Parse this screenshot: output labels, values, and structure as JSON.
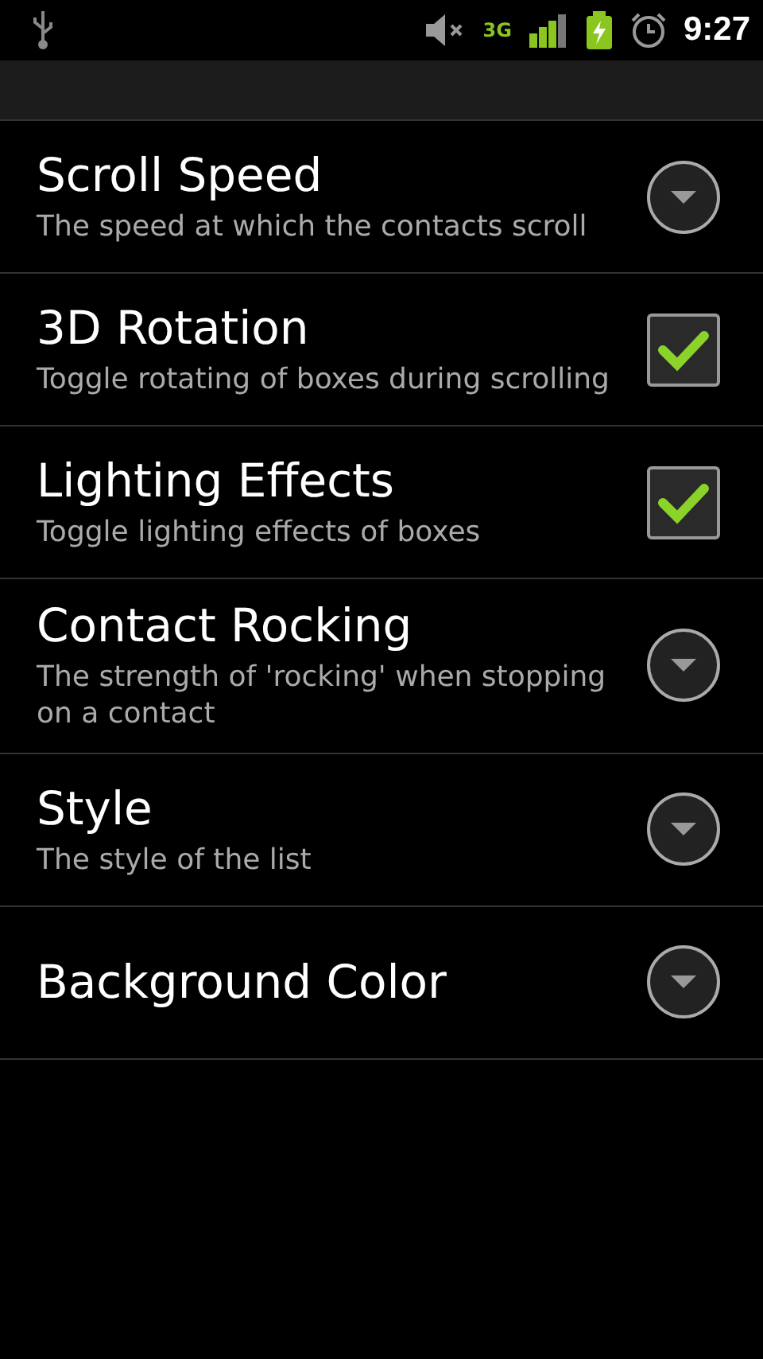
{
  "status_bar": {
    "network_label": "3G",
    "time": "9:27"
  },
  "settings": [
    {
      "kind": "dropdown",
      "title": "Scroll Speed",
      "summary": "The speed at which the contacts scroll"
    },
    {
      "kind": "checkbox",
      "title": "3D Rotation",
      "summary": "Toggle rotating of boxes during scrolling",
      "checked": true
    },
    {
      "kind": "checkbox",
      "title": "Lighting Effects",
      "summary": "Toggle lighting effects of boxes",
      "checked": true
    },
    {
      "kind": "dropdown",
      "title": "Contact Rocking",
      "summary": "The strength of 'rocking' when stopping on a contact"
    },
    {
      "kind": "dropdown",
      "title": "Style",
      "summary": "The style of the list"
    },
    {
      "kind": "dropdown",
      "title": "Background Color"
    }
  ]
}
